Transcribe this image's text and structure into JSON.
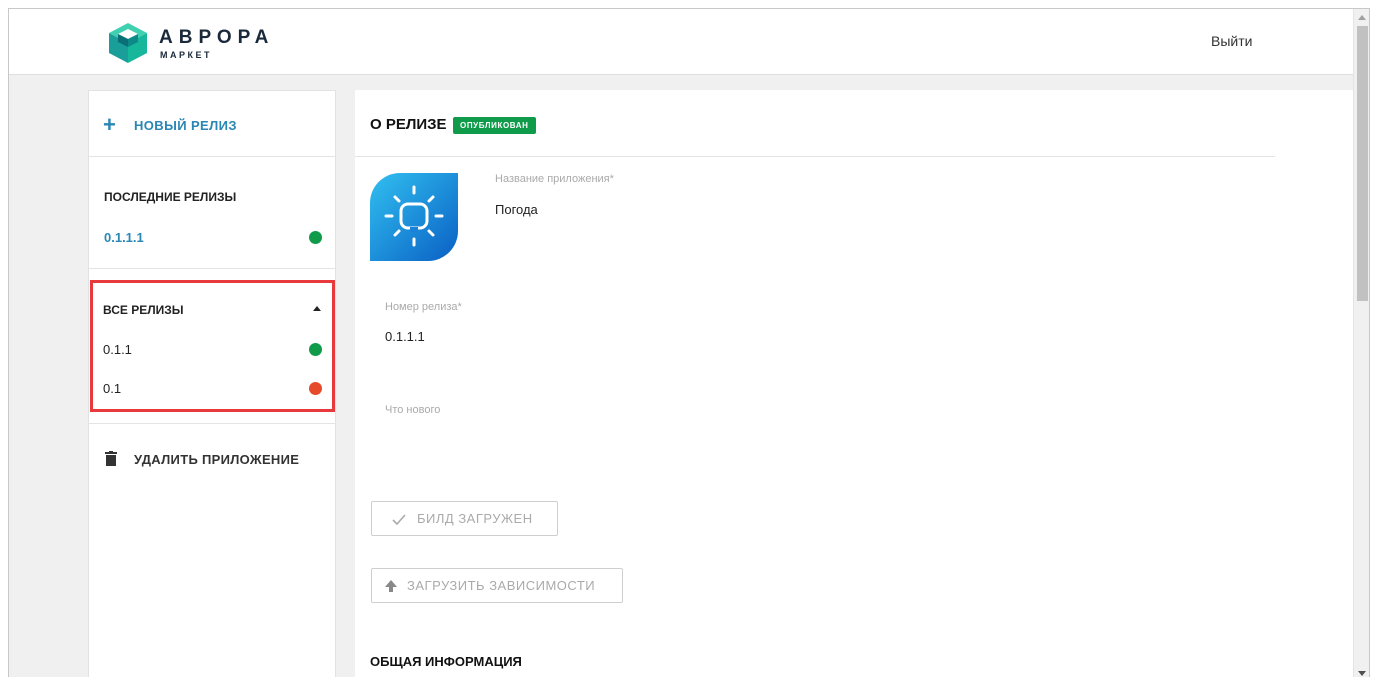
{
  "header": {
    "brand_title": "АВРОРА",
    "brand_subtitle": "МАРКЕТ",
    "logout_label": "Выйти"
  },
  "sidebar": {
    "new_release_label": "НОВЫЙ РЕЛИЗ",
    "recent": {
      "title": "ПОСЛЕДНИЕ РЕЛИЗЫ",
      "items": [
        {
          "version": "0.1.1.1",
          "status_color": "#0f9b4a"
        }
      ]
    },
    "all": {
      "title": "ВСЕ РЕЛИЗЫ",
      "items": [
        {
          "version": "0.1.1",
          "status_color": "#0f9b4a"
        },
        {
          "version": "0.1",
          "status_color": "#e64a2a"
        }
      ]
    },
    "delete_label": "УДАЛИТЬ ПРИЛОЖЕНИЕ"
  },
  "main": {
    "section_title": "О РЕЛИЗЕ",
    "status_badge": "ОПУБЛИКОВАН",
    "app_name_label": "Название приложения*",
    "app_name_value": "Погода",
    "release_number_label": "Номер релиза*",
    "release_number_value": "0.1.1.1",
    "whats_new_label": "Что нового",
    "build_button_label": "БИЛД ЗАГРУЖЕН",
    "deps_button_label": "ЗАГРУЗИТЬ ЗАВИСИМОСТИ",
    "general_info_title": "ОБЩАЯ ИНФОРМАЦИЯ"
  },
  "colors": {
    "accent": "#2a86b4",
    "published": "#0f9b4a",
    "error": "#e64a2a",
    "highlight": "#e8393d"
  },
  "icons": [
    "logo-cube-icon",
    "plus-icon",
    "caret-up-icon",
    "trash-icon",
    "app-weather-icon",
    "check-icon",
    "upload-arrow-icon"
  ]
}
